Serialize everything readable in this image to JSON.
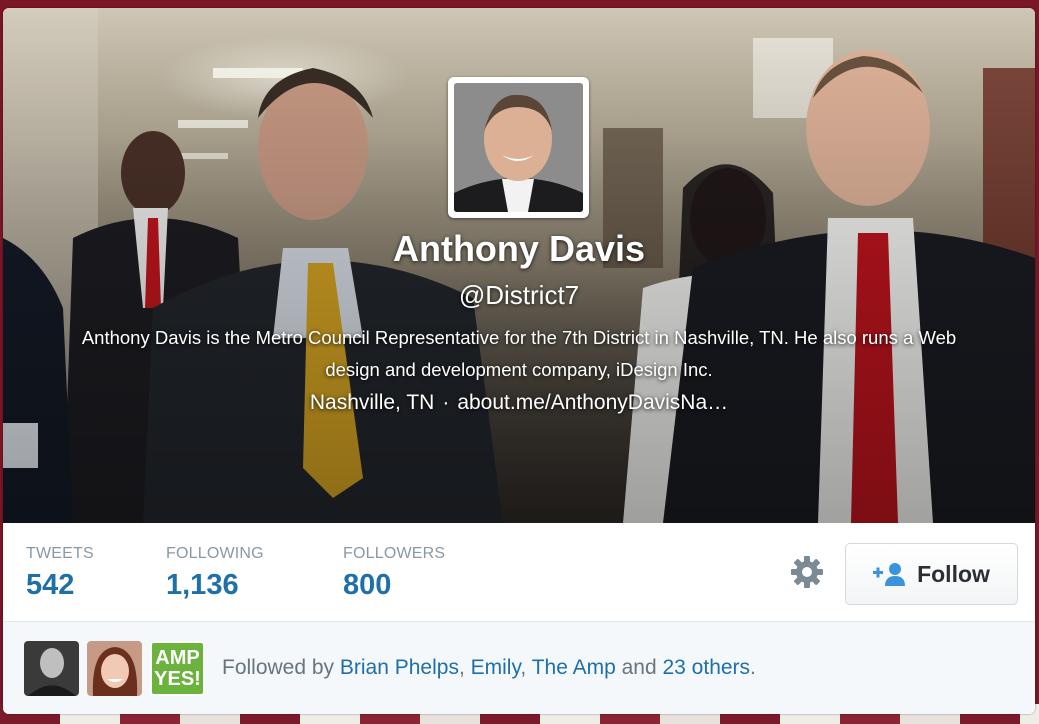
{
  "profile": {
    "name": "Anthony Davis",
    "handle": "@District7",
    "bio": "Anthony Davis is the Metro Council Representative for the 7th District in Nashville, TN. He also runs a Web design and development company, iDesign Inc.",
    "location": "Nashville, TN",
    "separator": "·",
    "url": "about.me/AnthonyDavisNa…"
  },
  "stats": {
    "tweets_label": "TWEETS",
    "tweets_value": "542",
    "following_label": "FOLLOWING",
    "following_value": "1,136",
    "followers_label": "FOLLOWERS",
    "followers_value": "800"
  },
  "actions": {
    "follow_label": "Follow",
    "settings_icon": "gear-icon",
    "follow_icon": "add-user-icon"
  },
  "followed_by": {
    "prefix": "Followed by ",
    "user1": "Brian Phelps",
    "sep1": ", ",
    "user2": "Emily",
    "sep2": ", ",
    "user3": "The Amp",
    "and": " and ",
    "others": "23 others",
    "suffix": ".",
    "amp_logo_line1": "AMP",
    "amp_logo_line2": "YES!"
  },
  "colors": {
    "link": "#1f6fa8",
    "muted": "#8899a6",
    "amp_green": "#6cb33e"
  }
}
